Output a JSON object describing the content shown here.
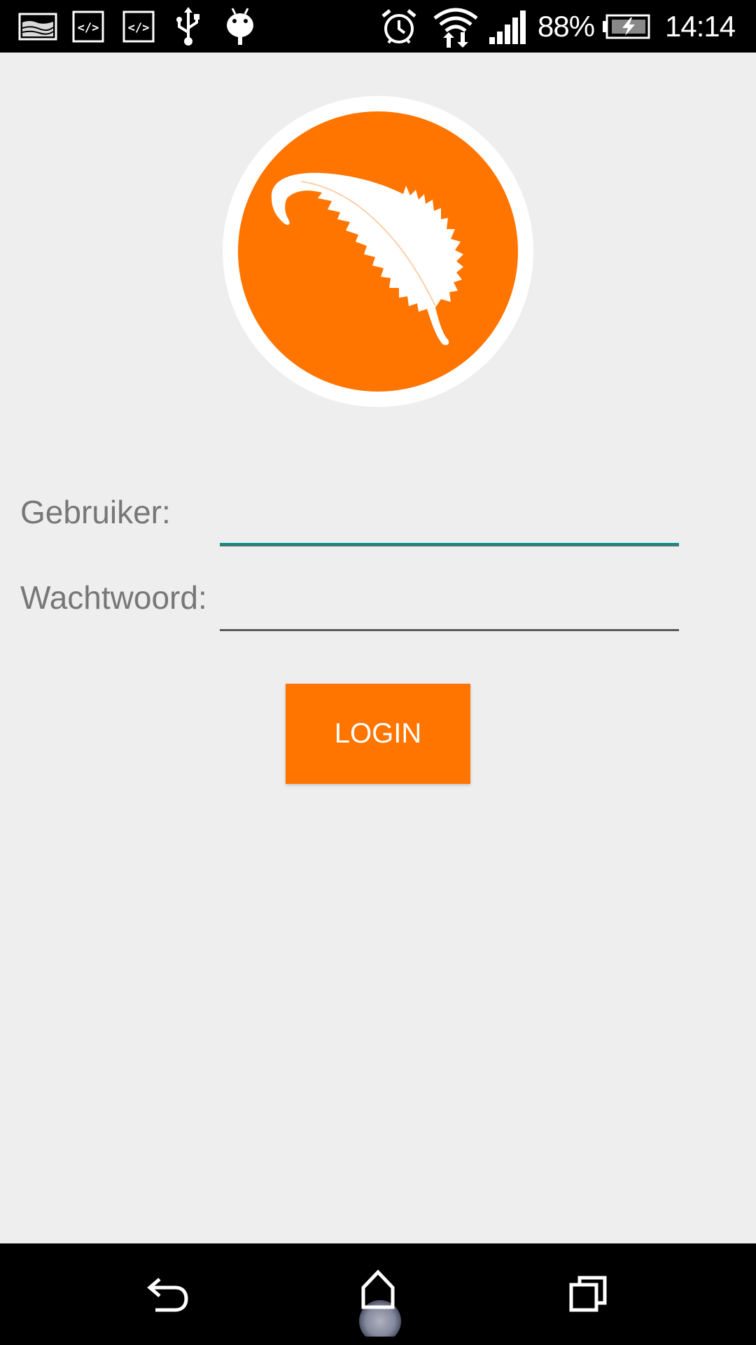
{
  "status_bar": {
    "icons_left": [
      "screenshot-icon",
      "code-icon",
      "code-icon",
      "usb-icon",
      "android-debug-icon"
    ],
    "icons_right": [
      "alarm-icon",
      "wifi-icon",
      "signal-icon"
    ],
    "battery_percent": "88%",
    "battery_level": 0.88,
    "charging": true,
    "time": "14:14"
  },
  "logo": {
    "icon": "feather-icon",
    "color": "#ff7500"
  },
  "form": {
    "username_label": "Gebruiker:",
    "username_value": "",
    "password_label": "Wachtwoord:",
    "password_value": "",
    "login_label": "LOGIN"
  },
  "nav_bar": {
    "buttons": [
      "back-icon",
      "home-icon",
      "recent-apps-icon"
    ]
  },
  "colors": {
    "accent": "#ff7500",
    "focus_underline": "#009688",
    "background": "#eeeeee"
  }
}
